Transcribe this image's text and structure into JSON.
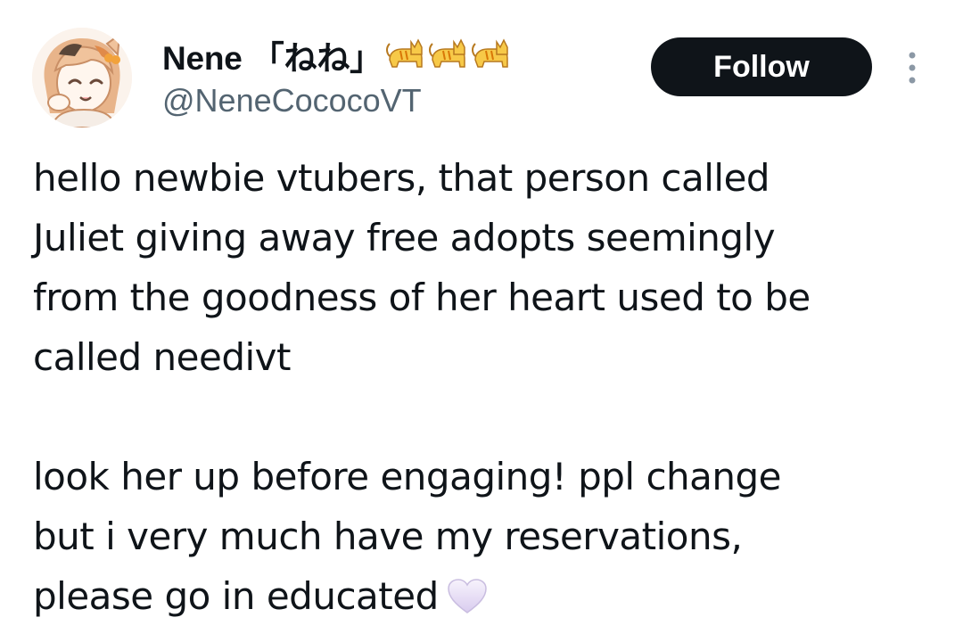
{
  "author": {
    "display_name": "Nene 「ねね」",
    "name_emoji": [
      "cat-emoji",
      "cat-emoji",
      "cat-emoji"
    ],
    "handle": "@NeneCococoVT",
    "avatar_icon": "anime-avatar"
  },
  "actions": {
    "follow_label": "Follow",
    "more_icon": "more-vertical-icon"
  },
  "tweet": {
    "paragraph_1": {
      "line_1": "hello newbie vtubers, that person called",
      "line_2": "Juliet giving away free adopts seemingly",
      "line_3": "from the goodness of her heart used to be",
      "line_4": "called needivt"
    },
    "paragraph_2": {
      "line_1": "look her up before engaging! ppl change",
      "line_2": "but i very much have my reservations,",
      "line_3": "please go in educated"
    },
    "trailing_emoji": "white-heart-emoji"
  },
  "colors": {
    "text_primary": "#0f1419",
    "text_secondary": "#536471",
    "follow_bg": "#0f1419",
    "follow_text": "#ffffff",
    "heart": "#e6dcf5"
  }
}
